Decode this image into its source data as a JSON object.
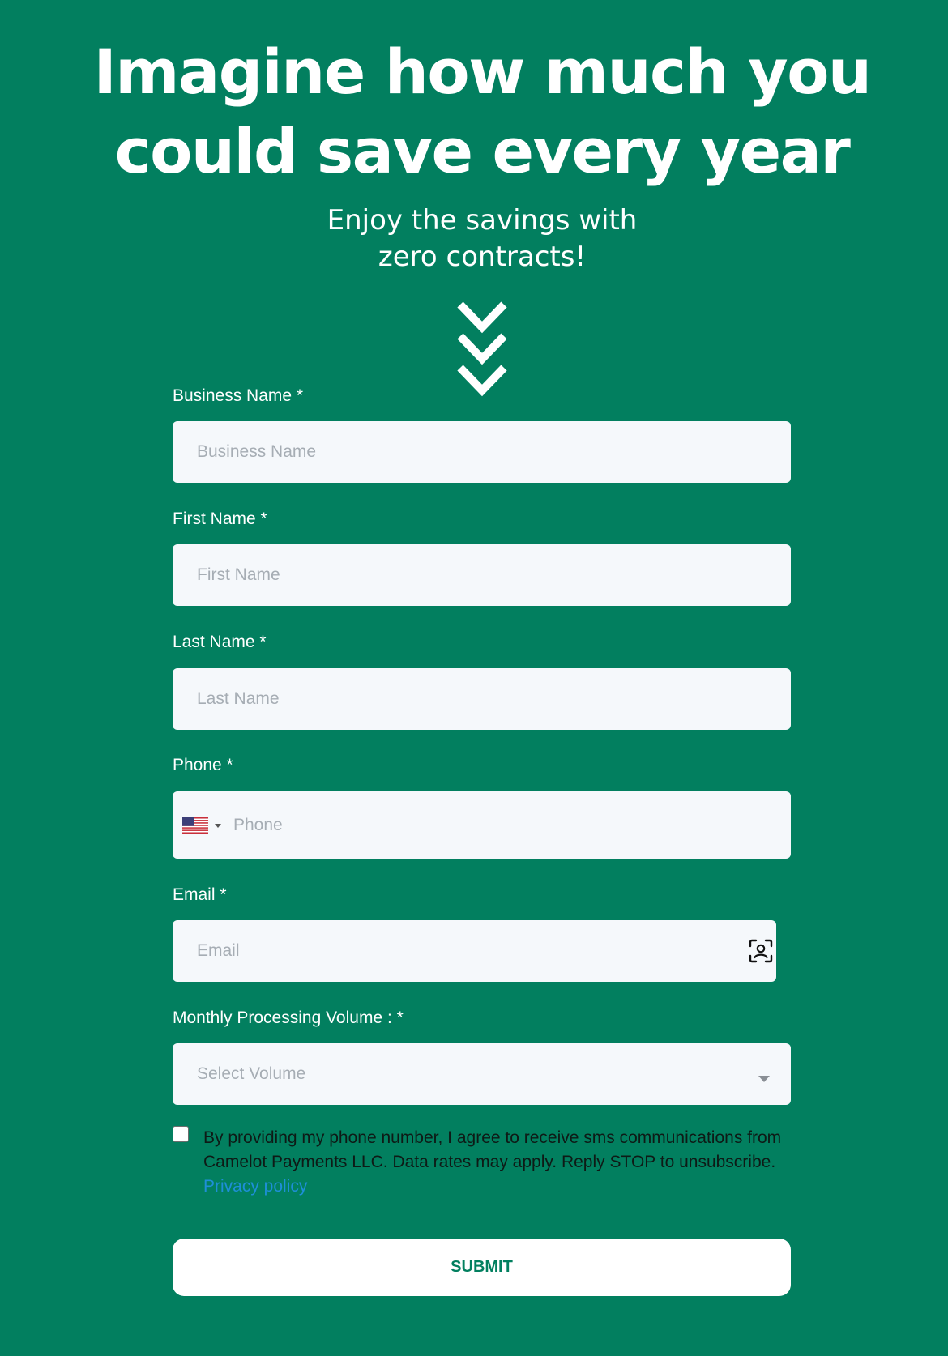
{
  "hero": {
    "headline_line1": "Imagine how much you",
    "headline_line2": "could save every year",
    "subhead_line1": "Enjoy the savings with",
    "subhead_line2": "zero contracts!",
    "arrow_icon": "triple-chevron-down-icon"
  },
  "form": {
    "business_name": {
      "label": "Business Name *",
      "placeholder": "Business Name",
      "value": ""
    },
    "first_name": {
      "label": "First Name *",
      "placeholder": "First Name",
      "value": ""
    },
    "last_name": {
      "label": "Last Name *",
      "placeholder": "Last Name",
      "value": ""
    },
    "phone": {
      "label": "Phone *",
      "placeholder": "Phone",
      "value": "",
      "country_icon": "us-flag-icon"
    },
    "email": {
      "label": "Email *",
      "placeholder": "Email",
      "value": "",
      "contact_icon": "contact-card-icon"
    },
    "volume": {
      "label": "Monthly Processing Volume : *",
      "selected": "Select Volume"
    },
    "consent": {
      "checked": false,
      "text": "By providing my phone number, I agree to receive sms communications from Camelot Payments LLC. Data rates may apply. Reply STOP to unsubscribe.",
      "link": "Privacy policy"
    },
    "submit_label": "SUBMIT"
  },
  "colors": {
    "background": "#027f5f",
    "input_background": "#f5f8fb",
    "placeholder": "#a6adb4",
    "link": "#1e8fd8",
    "button_text": "#027f5f"
  }
}
